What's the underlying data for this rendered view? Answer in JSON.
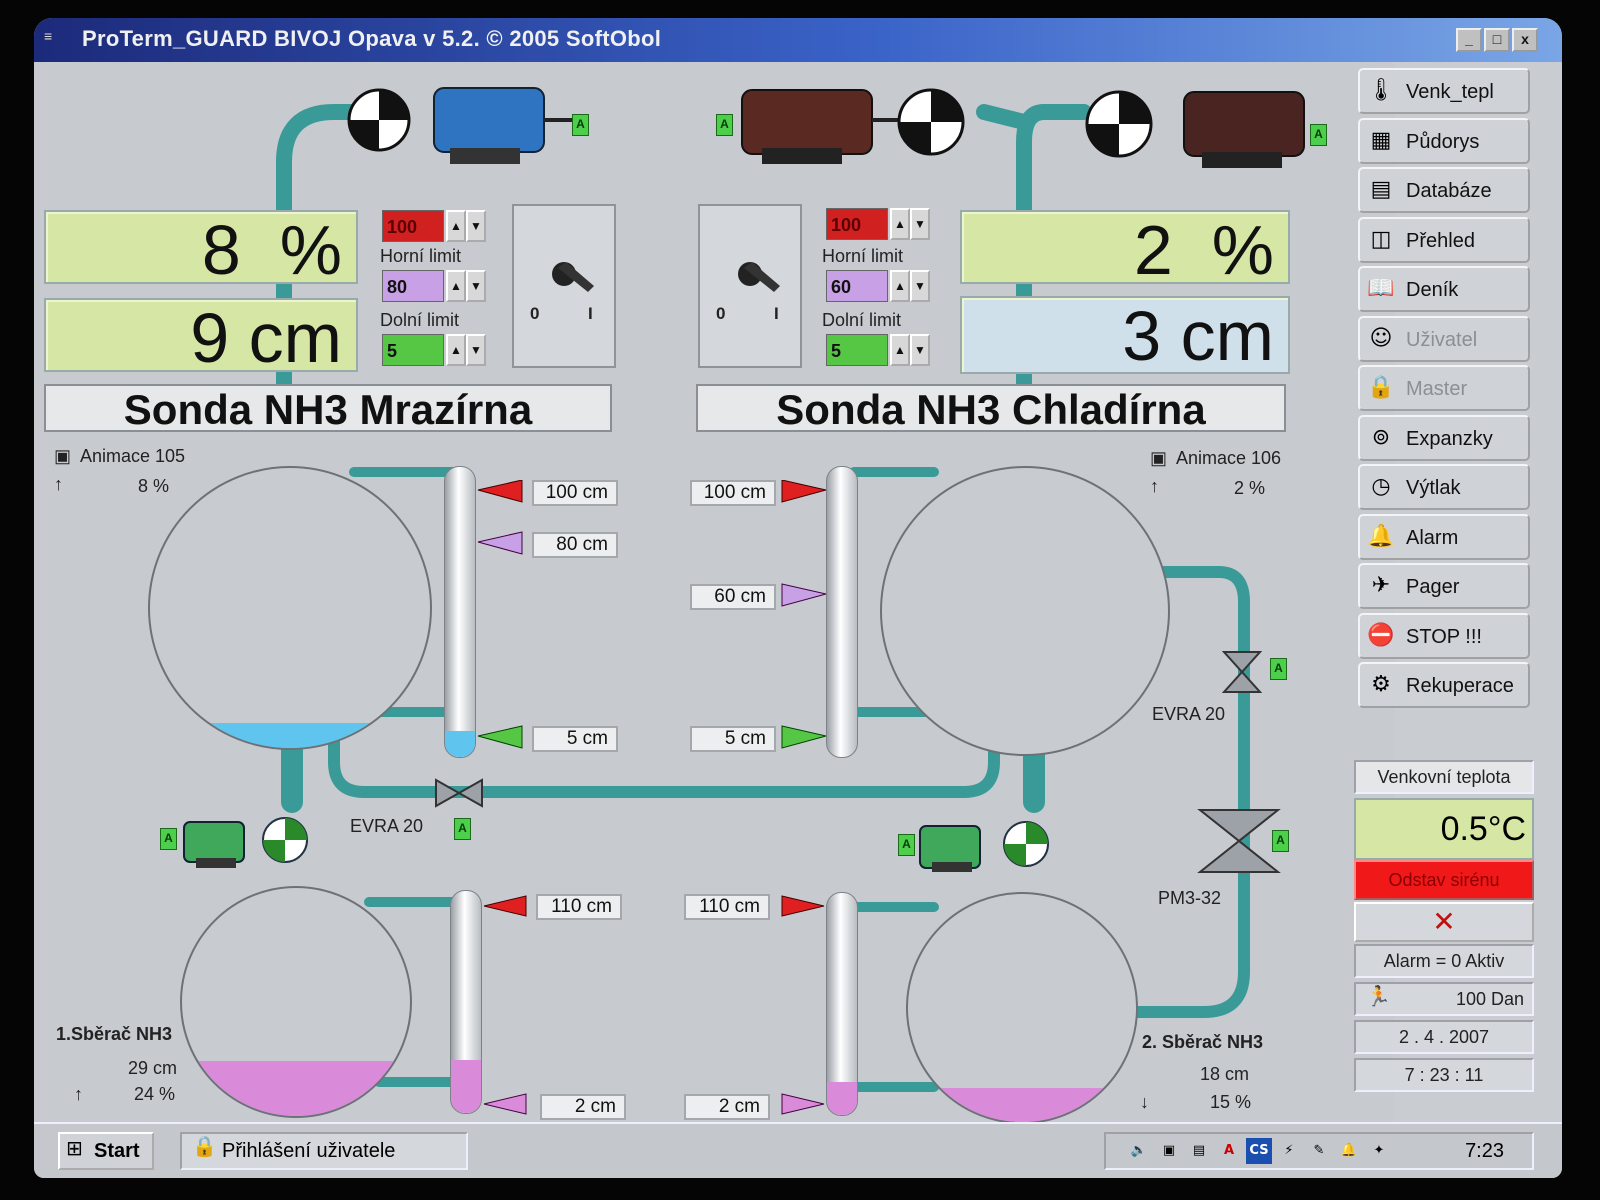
{
  "window": {
    "title": "ProTerm_GUARD BIVOJ Opava v 5.2. © 2005 SoftObol",
    "minimize": "_",
    "maximize": "□",
    "close": "x"
  },
  "left": {
    "percent": "8  %",
    "level": "9 cm",
    "probe_label": "Sonda NH3 Mrazírna",
    "limit_top_value": "100",
    "upper_limit_label": "Horní limit",
    "upper_limit_value": "80",
    "lower_limit_label": "Dolní limit",
    "lower_limit_value": "5",
    "switch_0": "0",
    "switch_1": "I",
    "anim_label": "Animace 105",
    "anim_percent": "8 %",
    "markers": [
      "100 cm",
      "80 cm",
      "5 cm"
    ],
    "valve_label": "EVRA 20",
    "collector_label": "1.Sběrač NH3",
    "collector_level": "29 cm",
    "collector_percent": "24 %",
    "collector_markers": [
      "110 cm",
      "2 cm"
    ],
    "vessel_fill": 0.09,
    "collector_fill": 0.24
  },
  "right": {
    "percent": "2  %",
    "level": "3 cm",
    "probe_label": "Sonda NH3 Chladírna",
    "limit_top_value": "100",
    "upper_limit_label": "Horní limit",
    "upper_limit_value": "60",
    "lower_limit_label": "Dolní limit",
    "lower_limit_value": "5",
    "switch_0": "0",
    "switch_1": "I",
    "anim_label": "Animace 106",
    "anim_percent": "2 %",
    "markers": [
      "100 cm",
      "60 cm",
      "5 cm"
    ],
    "valve_label": "EVRA 20",
    "valve2_label": "PM3-32",
    "collector_label": "2. Sběrač NH3",
    "collector_level": "18 cm",
    "collector_percent": "15 %",
    "collector_markers": [
      "110 cm",
      "2 cm"
    ],
    "vessel_fill": 0.0,
    "collector_fill": 0.15
  },
  "badge": "A",
  "sidebar": {
    "buttons": [
      {
        "label": "Venk_tepl",
        "icon": "thermometer-icon",
        "enabled": true
      },
      {
        "label": "Půdorys",
        "icon": "floorplan-icon",
        "enabled": true
      },
      {
        "label": "Databáze",
        "icon": "database-icon",
        "enabled": true
      },
      {
        "label": "Přehled",
        "icon": "overview-icon",
        "enabled": true
      },
      {
        "label": "Deník",
        "icon": "book-icon",
        "enabled": true
      },
      {
        "label": "Uživatel",
        "icon": "user-icon",
        "enabled": false
      },
      {
        "label": "Master",
        "icon": "lock-icon",
        "enabled": false
      },
      {
        "label": "Expanzky",
        "icon": "binoculars-icon",
        "enabled": true
      },
      {
        "label": "Výtlak",
        "icon": "clock-icon",
        "enabled": true
      },
      {
        "label": "Alarm",
        "icon": "bell-icon",
        "enabled": true
      },
      {
        "label": "Pager",
        "icon": "pager-icon",
        "enabled": true
      },
      {
        "label": "STOP !!!",
        "icon": "stop-icon",
        "enabled": true
      },
      {
        "label": "Rekuperace",
        "icon": "recuperation-icon",
        "enabled": true
      }
    ],
    "outdoor_label": "Venkovní teplota",
    "outdoor_value": "0.5°C",
    "siren_button": "Odstav sirénu",
    "close_x": "✕",
    "alarm_status": "Alarm =  0 Aktiv",
    "dan_status": "100 Dan",
    "date": "2 . 4 . 2007",
    "time": "7 : 23 : 11"
  },
  "taskbar": {
    "start": "Start",
    "task": "Přihlášení uživatele",
    "clock": "7:23"
  },
  "colors": {
    "lcd_green": "#d6e6a4",
    "pipe": "#3a9a98",
    "liquid_blue": "#5fc4ee",
    "liquid_pink": "#d98ad8",
    "alarm_red": "#e02020",
    "limit_violet": "#c7a0e6",
    "limit_green": "#55c744"
  }
}
